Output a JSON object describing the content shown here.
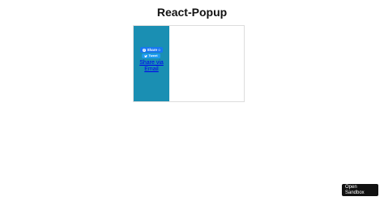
{
  "header": {
    "title": "React-Popup"
  },
  "share": {
    "facebook_label": "Share",
    "facebook_count": "0",
    "twitter_label": "Tweet",
    "email_label": "Share via Email"
  },
  "footer": {
    "sandbox_label": "Open Sandbox"
  },
  "colors": {
    "sidebar": "#1a8fb3",
    "facebook": "#1877f2",
    "twitter": "#1d9bf0",
    "link": "#0000ee",
    "sandbox_button": "#111111"
  },
  "icons": {
    "facebook": "facebook-icon",
    "twitter": "twitter-bird-icon"
  }
}
